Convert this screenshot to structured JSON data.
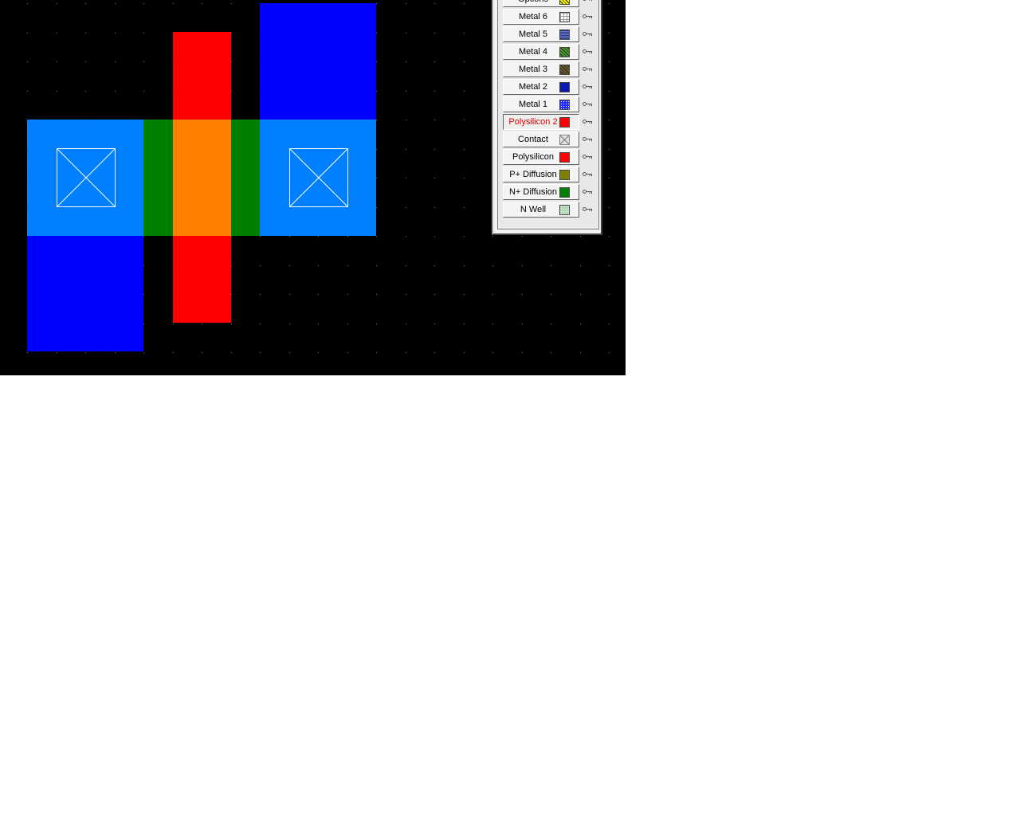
{
  "layers": [
    {
      "label": "Options",
      "swatch_icon": "options-crosshatch-icon",
      "color": "#ffff00"
    },
    {
      "label": "Metal 6",
      "swatch_icon": "metal6-grid-pattern-icon",
      "color": "#9c9c9c"
    },
    {
      "label": "Metal 5",
      "swatch_icon": "metal5-stripe-pattern-icon",
      "color": "#2a3a8a"
    },
    {
      "label": "Metal 4",
      "swatch_icon": "metal4-hatch-pattern-icon",
      "color": "#4aa02a"
    },
    {
      "label": "Metal 3",
      "swatch_icon": "metal3-hatch-pattern-icon",
      "color": "#6a5a2a"
    },
    {
      "label": "Metal 2",
      "swatch_icon": "metal2-solid-icon",
      "color": "#0a1ab0"
    },
    {
      "label": "Metal 1",
      "swatch_icon": "metal1-dot-pattern-icon",
      "color": "#1a2aff"
    },
    {
      "label": "Polysilicon 2",
      "swatch_icon": "polysilicon2-solid-icon",
      "color": "#ff0000",
      "selected": true
    },
    {
      "label": "Contact",
      "swatch_icon": "contact-x-icon",
      "color": "#c8c8c8"
    },
    {
      "label": "Polysilicon",
      "swatch_icon": "polysilicon-solid-icon",
      "color": "#ff0000"
    },
    {
      "label": "P+ Diffusion",
      "swatch_icon": "p-diffusion-solid-icon",
      "color": "#808000"
    },
    {
      "label": "N+ Diffusion",
      "swatch_icon": "n-diffusion-solid-icon",
      "color": "#008000"
    },
    {
      "label": "N Well",
      "swatch_icon": "nwell-dot-pattern-icon",
      "color": "#b0d8b0"
    }
  ],
  "colors": {
    "canvas_background": "#000000",
    "grid_dot": "#9a9a9a",
    "metal1_fill": "#0000ff",
    "diffusion_metal_overlap": "#0080ff",
    "n_diffusion": "#008000",
    "polysilicon": "#ff0000",
    "poly_diffusion_overlap": "#ff8000",
    "contact_outline": "#ffffff",
    "selected_label": "#e00000"
  }
}
